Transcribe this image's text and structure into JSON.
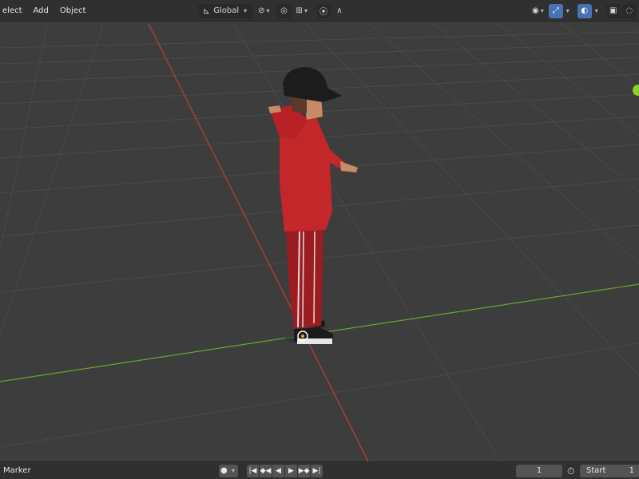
{
  "header": {
    "menus": [
      {
        "label": "elect"
      },
      {
        "label": "Add"
      },
      {
        "label": "Object"
      }
    ],
    "orientation": {
      "label": "Global"
    },
    "icons": [
      "transform-orientation-icon",
      "pivot-link-icon",
      "snap-icon",
      "snap-increment-icon",
      "proportional-edit-icon",
      "falloff-icon",
      "visibility-icon",
      "gizmo-icon",
      "overlay-icon",
      "xray-icon"
    ]
  },
  "colors": {
    "viewport_bg": "#3d3d3d",
    "grid_line": "#4a4a4a",
    "x_axis": "#c83a3a",
    "y_axis": "#6aa52f",
    "accent_blue": "#4772b3",
    "hoodie_red": "#c4272a"
  },
  "timeline": {
    "marker_label": "Marker",
    "current_frame": "1",
    "start_label": "Start",
    "start_value": "1"
  }
}
